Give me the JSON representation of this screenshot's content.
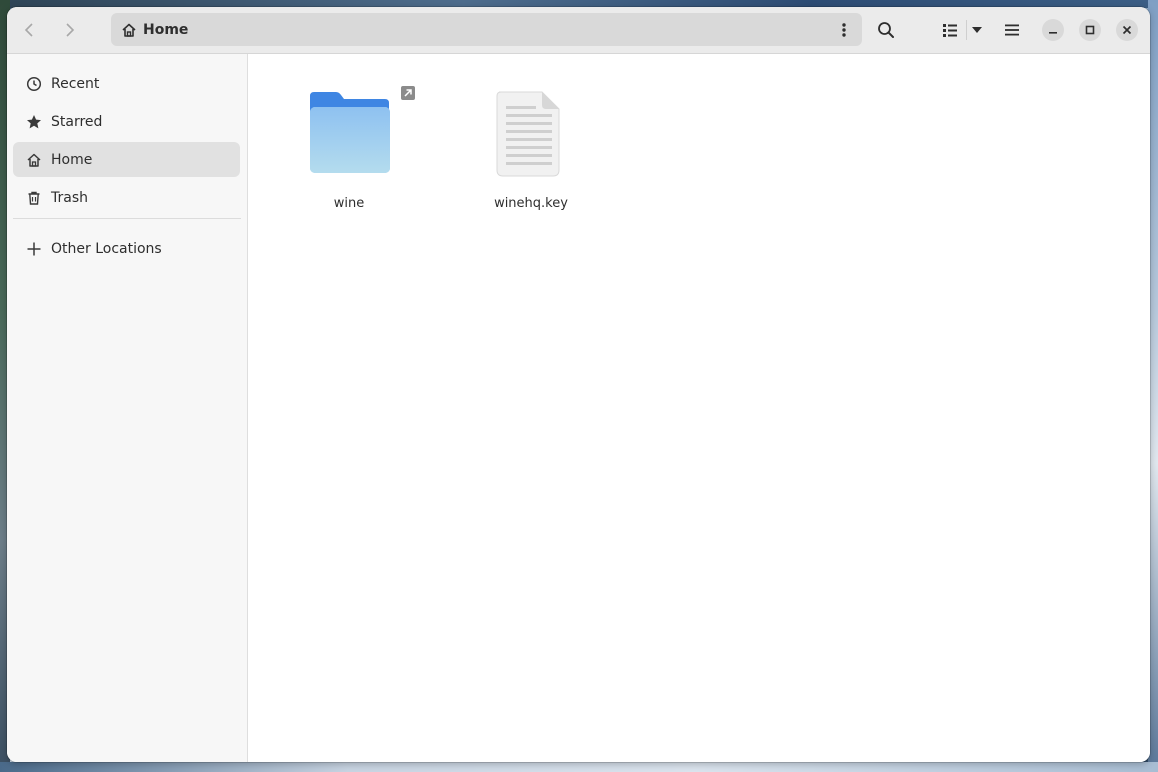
{
  "window": {
    "location": "Home"
  },
  "sidebar": {
    "items": [
      {
        "label": "Recent",
        "icon": "clock-icon"
      },
      {
        "label": "Starred",
        "icon": "star-icon"
      },
      {
        "label": "Home",
        "icon": "home-icon",
        "selected": true
      },
      {
        "label": "Trash",
        "icon": "trash-icon"
      }
    ],
    "other_locations": "Other Locations"
  },
  "files": [
    {
      "name": "wine",
      "type": "folder",
      "symlink": true
    },
    {
      "name": "winehq.key",
      "type": "text-file"
    }
  ],
  "colors": {
    "folder_top": "#3f86e3",
    "folder_body": "#9fcfef",
    "selected_bg": "#e1e1e1"
  }
}
